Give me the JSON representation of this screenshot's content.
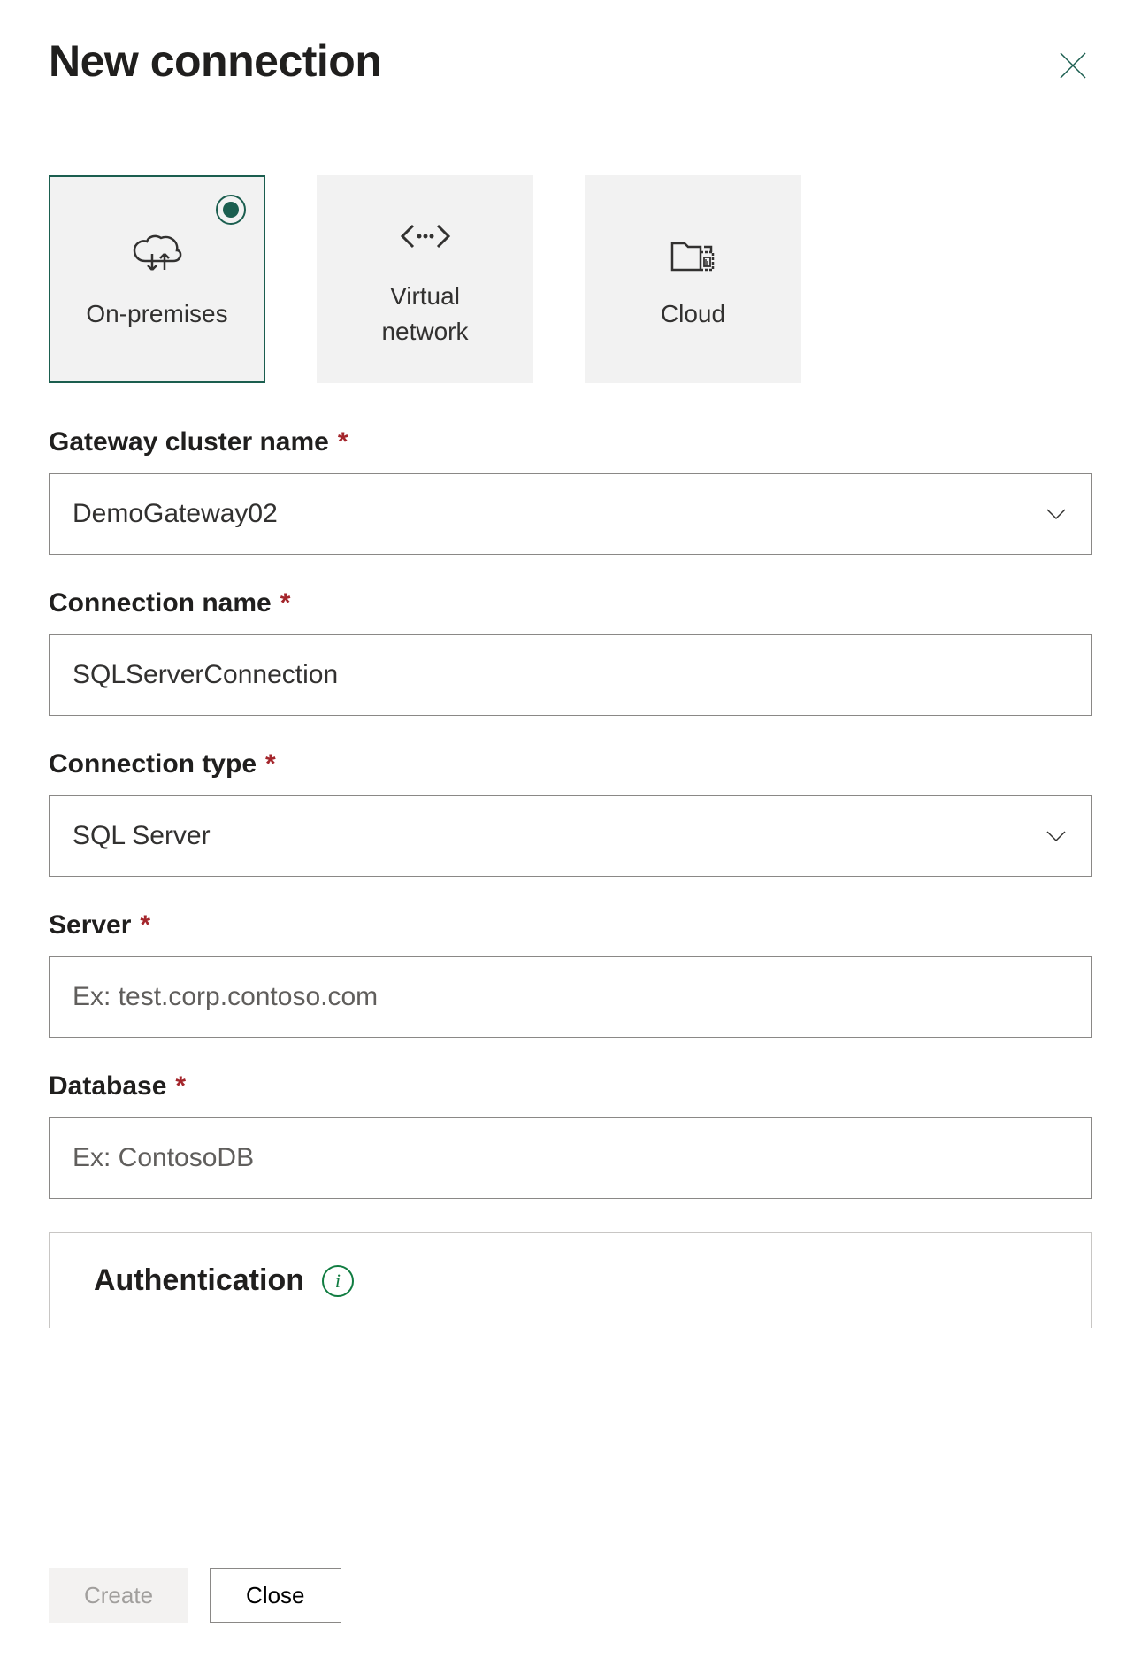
{
  "title": "New connection",
  "tiles": {
    "onprem": "On-premises",
    "vnet": "Virtual\nnetwork",
    "cloud": "Cloud"
  },
  "fields": {
    "gateway": {
      "label": "Gateway cluster name",
      "value": "DemoGateway02"
    },
    "conn_name": {
      "label": "Connection name",
      "value": "SQLServerConnection"
    },
    "conn_type": {
      "label": "Connection type",
      "value": "SQL Server"
    },
    "server": {
      "label": "Server",
      "placeholder": "Ex: test.corp.contoso.com",
      "value": ""
    },
    "database": {
      "label": "Database",
      "placeholder": "Ex: ContosoDB",
      "value": ""
    }
  },
  "auth": {
    "title": "Authentication"
  },
  "buttons": {
    "create": "Create",
    "close": "Close"
  }
}
